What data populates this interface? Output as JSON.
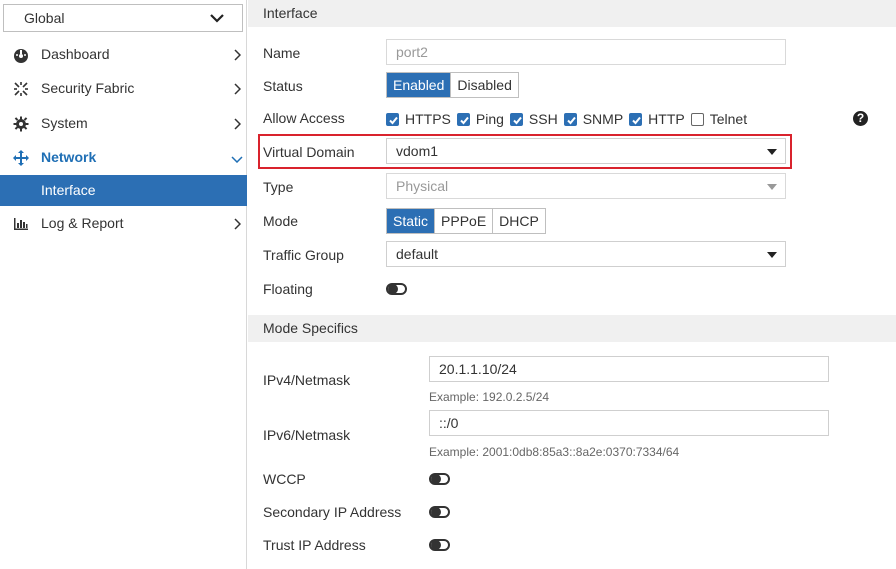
{
  "sidebar": {
    "vdom": "Global",
    "items": [
      {
        "label": "Dashboard",
        "icon": "dashboard-icon"
      },
      {
        "label": "Security Fabric",
        "icon": "security-fabric-icon"
      },
      {
        "label": "System",
        "icon": "gear-icon"
      },
      {
        "label": "Network",
        "icon": "network-icon"
      },
      {
        "label": "Log & Report",
        "icon": "bar-chart-icon"
      }
    ],
    "sub_item": "Interface"
  },
  "interface": {
    "section_title": "Interface",
    "name_label": "Name",
    "name_value": "port2",
    "status_label": "Status",
    "status_options": [
      "Enabled",
      "Disabled"
    ],
    "status_selected": "Enabled",
    "allow_access_label": "Allow Access",
    "allow_access": [
      {
        "label": "HTTPS",
        "checked": true
      },
      {
        "label": "Ping",
        "checked": true
      },
      {
        "label": "SSH",
        "checked": true
      },
      {
        "label": "SNMP",
        "checked": true
      },
      {
        "label": "HTTP",
        "checked": true
      },
      {
        "label": "Telnet",
        "checked": false
      }
    ],
    "vdom_label": "Virtual Domain",
    "vdom_value": "vdom1",
    "type_label": "Type",
    "type_value": "Physical",
    "mode_label": "Mode",
    "mode_options": [
      "Static",
      "PPPoE",
      "DHCP"
    ],
    "mode_selected": "Static",
    "traffic_group_label": "Traffic Group",
    "traffic_group_value": "default",
    "floating_label": "Floating"
  },
  "mode_specifics": {
    "section_title": "Mode Specifics",
    "ipv4_label": "IPv4/Netmask",
    "ipv4_value": "20.1.1.10/24",
    "ipv4_hint": "Example: 192.0.2.5/24",
    "ipv6_label": "IPv6/Netmask",
    "ipv6_value": "::/0",
    "ipv6_hint": "Example: 2001:0db8:85a3::8a2e:0370:7334/64",
    "wccp_label": "WCCP",
    "secondary_ip_label": "Secondary IP Address",
    "trust_ip_label": "Trust IP Address"
  },
  "colors": {
    "accent": "#2c6fb4",
    "highlight": "#d9232d"
  }
}
